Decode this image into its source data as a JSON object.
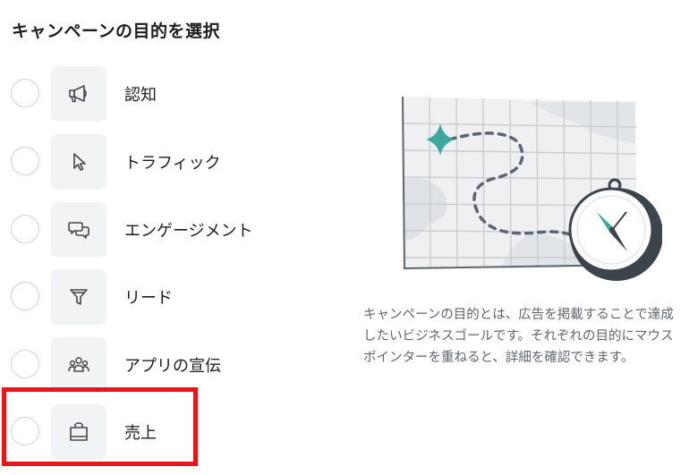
{
  "title": "キャンペーンの目的を選択",
  "options": [
    {
      "label": "認知",
      "icon": "megaphone-icon"
    },
    {
      "label": "トラフィック",
      "icon": "cursor-icon"
    },
    {
      "label": "エンゲージメント",
      "icon": "chat-bubbles-icon"
    },
    {
      "label": "リード",
      "icon": "funnel-icon"
    },
    {
      "label": "アプリの宣伝",
      "icon": "people-icon"
    },
    {
      "label": "売上",
      "icon": "shopping-bag-icon"
    }
  ],
  "description": "キャンペーンの目的とは、広告を掲載することで達成したいビジネスゴールです。それぞれの目的にマウスポインターを重ねると、詳細を確認できます。",
  "colors": {
    "highlight": "#e8151b",
    "accent": "#3ea8a0",
    "icon_bg": "#f2f3f5"
  }
}
